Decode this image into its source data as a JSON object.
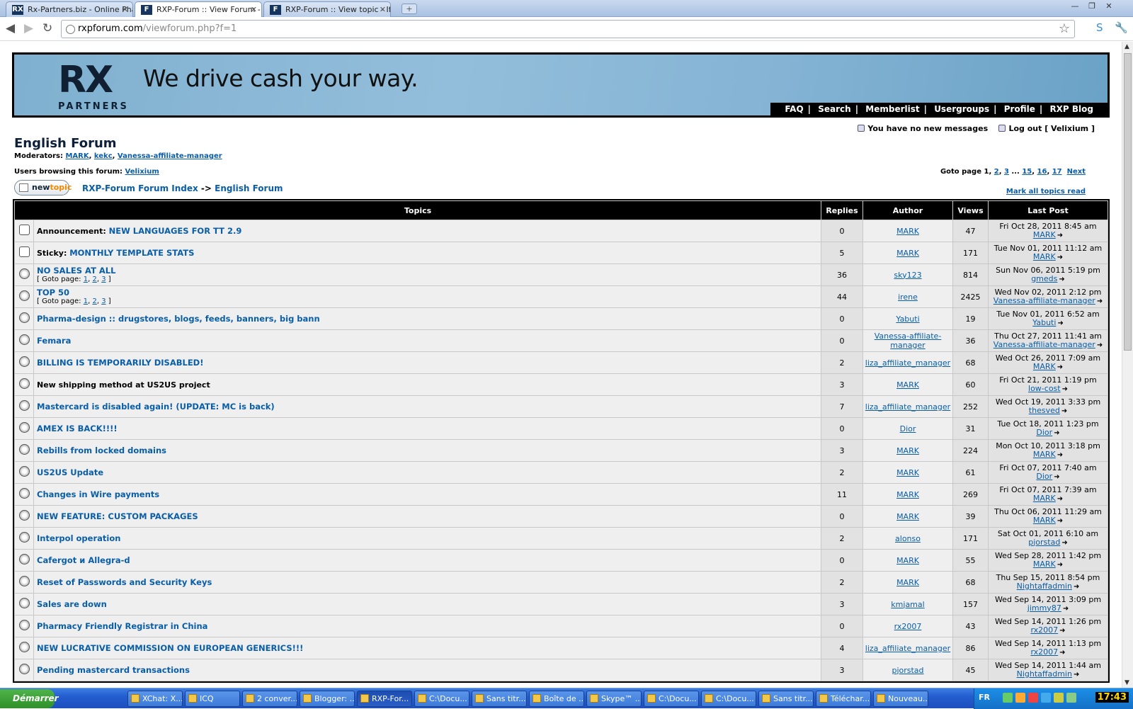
{
  "browser": {
    "tabs": [
      {
        "label": "Rx-Partners.biz - Online Pharm",
        "icon": "rx-favicon"
      },
      {
        "label": "RXP-Forum :: View Forum - En",
        "icon": "f-favicon",
        "active": true
      },
      {
        "label": "RXP-Forum :: View topic - If yo",
        "icon": "f-favicon"
      }
    ],
    "url_host": "rxpforum.com",
    "url_path": "/viewforum.php?f=1"
  },
  "banner": {
    "logo_text": "RX",
    "logo_sub": "PARTNERS",
    "tagline": "We drive cash your way.",
    "menu": [
      "FAQ",
      "Search",
      "Memberlist",
      "Usergroups",
      "Profile",
      "RXP Blog"
    ]
  },
  "status": {
    "messages": "You have no new messages",
    "logout": "Log out [ Velixium ]"
  },
  "forum": {
    "title": "English Forum",
    "moderators_label": "Moderators:",
    "moderators": [
      "MARK",
      "kekc",
      "Vanessa-affiliate-manager"
    ],
    "browsing_label": "Users browsing this forum:",
    "browsing_user": "Velixium",
    "goto_label": "Goto page",
    "goto_current": "1",
    "goto_pages": [
      "2",
      "3",
      "15",
      "16",
      "17"
    ],
    "goto_next": "Next",
    "new_topic_a": "new",
    "new_topic_b": "topic",
    "crumb_index": "RXP-Forum Forum Index",
    "crumb_arrow": "->",
    "crumb_forum": "English Forum",
    "mark_all": "Mark all topics read"
  },
  "table": {
    "headers": [
      "Topics",
      "Replies",
      "Author",
      "Views",
      "Last Post"
    ],
    "rows": [
      {
        "prefix": "Announcement:",
        "title": "NEW LANGUAGES FOR TT 2.9",
        "replies": "0",
        "author": "MARK",
        "views": "47",
        "lp_date": "Fri Oct 28, 2011 8:45 am",
        "lp_user": "MARK",
        "icon": "announcement-icon"
      },
      {
        "prefix": "Sticky:",
        "title": "MONTHLY TEMPLATE STATS",
        "replies": "5",
        "author": "MARK",
        "views": "171",
        "lp_date": "Tue Nov 01, 2011 11:12 am",
        "lp_user": "MARK",
        "icon": "sticky-icon"
      },
      {
        "prefix": "",
        "title": "NO SALES AT ALL",
        "pages": [
          "1",
          "2",
          "3"
        ],
        "replies": "36",
        "author": "sky123",
        "views": "814",
        "lp_date": "Sun Nov 06, 2011 5:19 pm",
        "lp_user": "gmeds",
        "icon": "topic-icon"
      },
      {
        "prefix": "",
        "title": "TOP 50",
        "pages": [
          "1",
          "2",
          "3"
        ],
        "replies": "44",
        "author": "irene",
        "views": "2425",
        "lp_date": "Wed Nov 02, 2011 2:12 pm",
        "lp_user": "Vanessa-affiliate-manager",
        "icon": "topic-icon"
      },
      {
        "prefix": "",
        "title": "Pharma-design :: drugstores, blogs, feeds, banners, big bann",
        "replies": "0",
        "author": "Yabuti",
        "views": "19",
        "lp_date": "Tue Nov 01, 2011 6:52 am",
        "lp_user": "Yabuti",
        "icon": "topic-icon"
      },
      {
        "prefix": "",
        "title": "Femara",
        "replies": "0",
        "author": "Vanessa-affiliate-manager",
        "views": "36",
        "lp_date": "Thu Oct 27, 2011 11:41 am",
        "lp_user": "Vanessa-affiliate-manager",
        "icon": "topic-icon"
      },
      {
        "prefix": "",
        "title": "BILLING IS TEMPORARILY DISABLED!",
        "replies": "2",
        "author": "liza_affiliate_manager",
        "views": "68",
        "lp_date": "Wed Oct 26, 2011 7:09 am",
        "lp_user": "MARK",
        "icon": "topic-icon"
      },
      {
        "prefix": "",
        "title": "New shipping method at US2US project",
        "plain": true,
        "replies": "3",
        "author": "MARK",
        "views": "60",
        "lp_date": "Fri Oct 21, 2011 1:19 pm",
        "lp_user": "low-cost",
        "icon": "topic-icon"
      },
      {
        "prefix": "",
        "title": "Mastercard is disabled again! (UPDATE: MC is back)",
        "replies": "7",
        "author": "liza_affiliate_manager",
        "views": "252",
        "lp_date": "Wed Oct 19, 2011 3:33 pm",
        "lp_user": "thesved",
        "icon": "topic-icon"
      },
      {
        "prefix": "",
        "title": "AMEX IS BACK!!!!",
        "replies": "0",
        "author": "Dior",
        "views": "31",
        "lp_date": "Tue Oct 18, 2011 1:23 pm",
        "lp_user": "Dior",
        "icon": "topic-icon"
      },
      {
        "prefix": "",
        "title": "Rebills from locked domains",
        "replies": "3",
        "author": "MARK",
        "views": "224",
        "lp_date": "Mon Oct 10, 2011 3:18 pm",
        "lp_user": "MARK",
        "icon": "topic-icon"
      },
      {
        "prefix": "",
        "title": "US2US Update",
        "replies": "2",
        "author": "MARK",
        "views": "61",
        "lp_date": "Fri Oct 07, 2011 7:40 am",
        "lp_user": "Dior",
        "icon": "topic-icon"
      },
      {
        "prefix": "",
        "title": "Changes in Wire payments",
        "replies": "11",
        "author": "MARK",
        "views": "269",
        "lp_date": "Fri Oct 07, 2011 7:39 am",
        "lp_user": "MARK",
        "icon": "topic-icon"
      },
      {
        "prefix": "",
        "title": "NEW FEATURE: CUSTOM PACKAGES",
        "replies": "0",
        "author": "MARK",
        "views": "39",
        "lp_date": "Thu Oct 06, 2011 11:29 am",
        "lp_user": "MARK",
        "icon": "topic-icon"
      },
      {
        "prefix": "",
        "title": "Interpol operation",
        "replies": "2",
        "author": "alonso",
        "views": "171",
        "lp_date": "Sat Oct 01, 2011 6:10 am",
        "lp_user": "pjorstad",
        "icon": "topic-icon"
      },
      {
        "prefix": "",
        "title": "Cafergot и Allegra-d",
        "replies": "0",
        "author": "MARK",
        "views": "55",
        "lp_date": "Wed Sep 28, 2011 1:42 pm",
        "lp_user": "MARK",
        "icon": "topic-icon"
      },
      {
        "prefix": "",
        "title": "Reset of Passwords and Security Keys",
        "replies": "2",
        "author": "MARK",
        "views": "68",
        "lp_date": "Thu Sep 15, 2011 8:54 pm",
        "lp_user": "Nightaffadmin",
        "icon": "topic-icon"
      },
      {
        "prefix": "",
        "title": "Sales are down",
        "replies": "3",
        "author": "kmjamal",
        "views": "157",
        "lp_date": "Wed Sep 14, 2011 3:09 pm",
        "lp_user": "jimmy87",
        "icon": "topic-icon"
      },
      {
        "prefix": "",
        "title": "Pharmacy Friendly Registrar in China",
        "replies": "0",
        "author": "rx2007",
        "views": "43",
        "lp_date": "Wed Sep 14, 2011 1:26 pm",
        "lp_user": "rx2007",
        "icon": "topic-icon"
      },
      {
        "prefix": "",
        "title": "NEW LUCRATIVE COMMISSION ON EUROPEAN GENERICS!!!",
        "replies": "4",
        "author": "liza_affiliate_manager",
        "views": "86",
        "lp_date": "Wed Sep 14, 2011 1:13 pm",
        "lp_user": "rx2007",
        "icon": "topic-icon"
      },
      {
        "prefix": "",
        "title": "Pending mastercard transactions",
        "replies": "3",
        "author": "pjorstad",
        "views": "45",
        "lp_date": "Wed Sep 14, 2011 1:44 am",
        "lp_user": "Nightaffadmin",
        "icon": "topic-icon"
      }
    ],
    "goto_page_label": "Goto page:"
  },
  "taskbar": {
    "start": "Démarrer",
    "items": [
      "XChat: X...",
      "ICQ",
      "2 conver...",
      "Blogger: ...",
      "RXP-For...",
      "C:\\Docu...",
      "Sans titr...",
      "Boîte de ...",
      "Skype™ ...",
      "C:\\Docu...",
      "C:\\Docu...",
      "Sans titr...",
      "Téléchar...",
      "Nouveau..."
    ],
    "lang": "FR",
    "clock": "17:43"
  },
  "colors": {
    "link": "#0a5ea8",
    "banner": "#8dbad8",
    "header_bg": "#000000",
    "accent": "#f08a00"
  }
}
